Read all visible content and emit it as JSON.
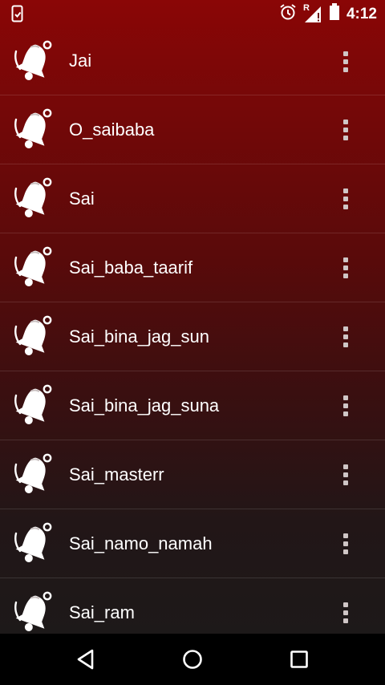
{
  "status_bar": {
    "time": "4:12",
    "roaming_indicator": "R",
    "left_icon": "phone-update-icon",
    "right_icons": [
      "alarm-clock-icon",
      "signal-icon",
      "battery-icon"
    ]
  },
  "colors": {
    "gradient_top": "#8a0606",
    "gradient_bottom": "#1d1919",
    "icon_fill": "#ffffff",
    "menu_dots": "#cfc6c6",
    "nav_bar": "#000000"
  },
  "ringtones": [
    {
      "label": "Jai"
    },
    {
      "label": "O_saibaba"
    },
    {
      "label": "Sai"
    },
    {
      "label": "Sai_baba_taarif"
    },
    {
      "label": "Sai_bina_jag_sun"
    },
    {
      "label": "Sai_bina_jag_suna"
    },
    {
      "label": "Sai_masterr"
    },
    {
      "label": "Sai_namo_namah"
    },
    {
      "label": "Sai_ram"
    }
  ],
  "row_icon": "bell-icon",
  "row_menu_icon": "more-vert-icon",
  "nav_bar": {
    "buttons": [
      "back-icon",
      "home-icon",
      "recents-icon"
    ]
  }
}
